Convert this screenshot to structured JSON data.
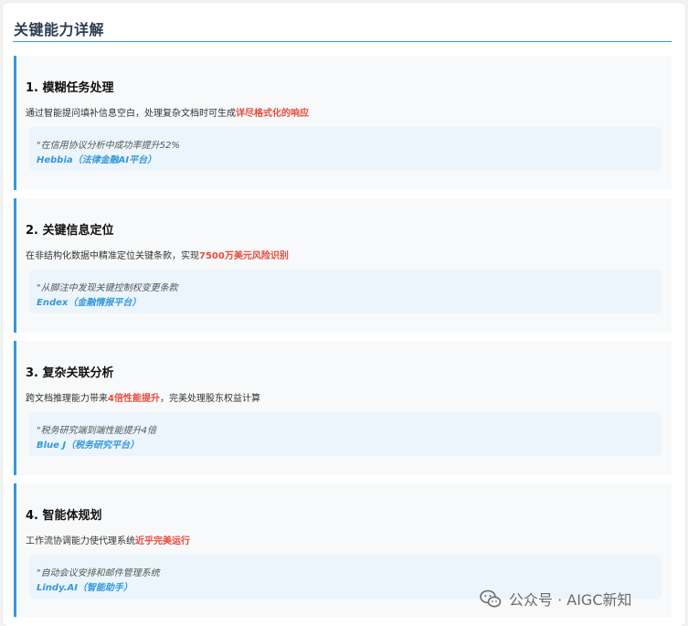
{
  "section_title": "关键能力详解",
  "cards": [
    {
      "title": "1. 模糊任务处理",
      "desc_pre": "通过智能提问填补信息空白，处理复杂文档时可生成",
      "desc_highlight": "详尽格式化的响应",
      "desc_post": "",
      "quote": "\"在信用协议分析中成功率提升52%",
      "source": "Hebbia（法律金融AI平台）"
    },
    {
      "title": "2. 关键信息定位",
      "desc_pre": "在非结构化数据中精准定位关键条款，实现",
      "desc_highlight": "7500万美元风险识别",
      "desc_post": "",
      "quote": "\"从脚注中发现关键控制权变更条款",
      "source": "Endex（金融情报平台）"
    },
    {
      "title": "3. 复杂关联分析",
      "desc_pre": "跨文档推理能力带来",
      "desc_highlight": "4倍性能提升",
      "desc_post": "，完美处理股东权益计算",
      "quote": "\"税务研究端到端性能提升4倍",
      "source": "Blue J（税务研究平台）"
    },
    {
      "title": "4. 智能体规划",
      "desc_pre": "工作流协调能力使代理系统",
      "desc_highlight": "近乎完美运行",
      "desc_post": "",
      "quote": "\"自动会议安排和邮件管理系统",
      "source": "Lindy.AI（智能助手）"
    }
  ],
  "watermark": {
    "text": "公众号 · AIGC新知",
    "icon": "wechat-icon"
  },
  "colors": {
    "accent": "#3498db",
    "highlight": "#e74c3c",
    "card_bg": "#f8f9fa",
    "quote_bg": "#ebf5fb",
    "title": "#2c3e50"
  }
}
